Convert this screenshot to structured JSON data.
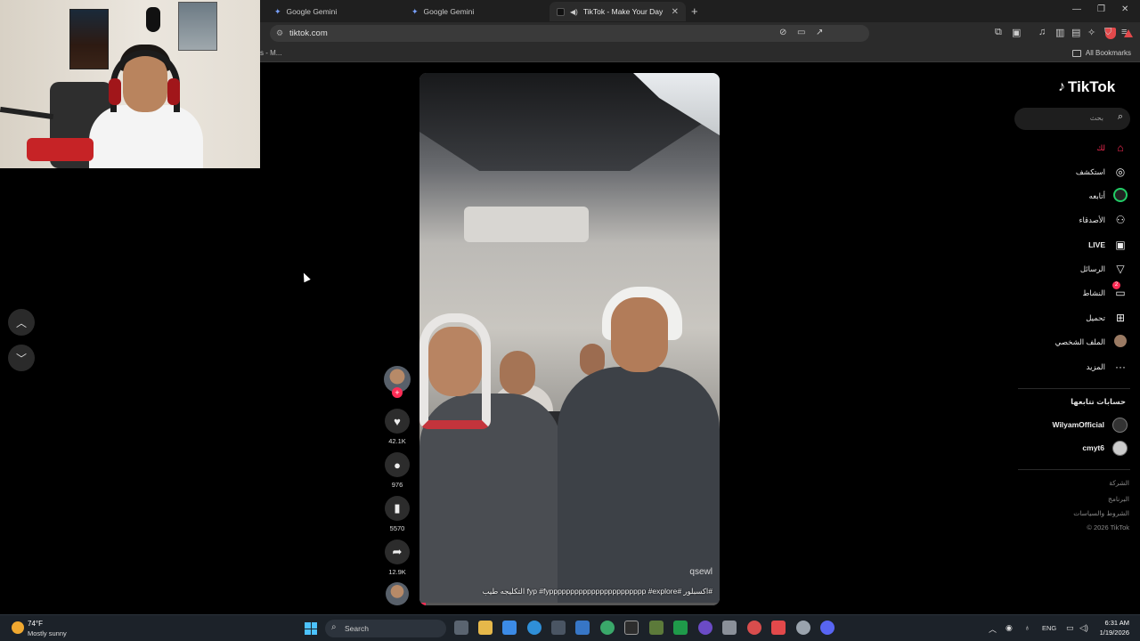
{
  "browser": {
    "tabs": [
      {
        "label": "Google Gemini",
        "type": "gemini"
      },
      {
        "label": "Google Gemini",
        "type": "gemini"
      },
      {
        "label": "TikTok - Make Your Day",
        "type": "tiktok",
        "active": true
      }
    ],
    "url": "tiktok.com",
    "bookmarks_partial": "s - M...",
    "all_bookmarks": "All Bookmarks"
  },
  "tiktok": {
    "logo": "TikTok",
    "search_placeholder": "بحث",
    "menu": [
      {
        "label": "لك",
        "icon": "home-icon",
        "active": true
      },
      {
        "label": "استكشف",
        "icon": "compass-icon"
      },
      {
        "label": "أتابعه",
        "icon": "following-avatar-icon"
      },
      {
        "label": "الأصدقاء",
        "icon": "friends-icon"
      },
      {
        "label": "LIVE",
        "icon": "live-icon"
      },
      {
        "label": "الرسائل",
        "icon": "messages-icon"
      },
      {
        "label": "النشاط",
        "icon": "activity-icon",
        "badge": "2"
      },
      {
        "label": "تحميل",
        "icon": "upload-icon"
      },
      {
        "label": "الملف الشخصي",
        "icon": "profile-icon"
      },
      {
        "label": "المزيد",
        "icon": "more-icon"
      }
    ],
    "following_title": "حسابات تتابعها",
    "following": [
      {
        "name": "WilyamOfficial"
      },
      {
        "name": "cmyt6"
      }
    ],
    "footer": [
      "الشركة",
      "البرنامج",
      "الشروط والسياسات",
      "© 2026 TikTok"
    ],
    "video": {
      "caption": "#اكسبلور #fyp #fyppppppppppppppppppppppp #explore التكليجه طيب",
      "watermark": "qsewl",
      "progress": 0.02
    },
    "actions": {
      "likes": "42.1K",
      "comments": "976",
      "saves": "5570",
      "shares": "12.9K"
    }
  },
  "taskbar": {
    "temp": "74°F",
    "condition": "Mostly sunny",
    "search": "Search",
    "lang": "ENG",
    "time": "6:31 AM",
    "date": "1/19/2026"
  },
  "colors": {
    "accent": "#fe2c55",
    "bg": "#000000"
  }
}
